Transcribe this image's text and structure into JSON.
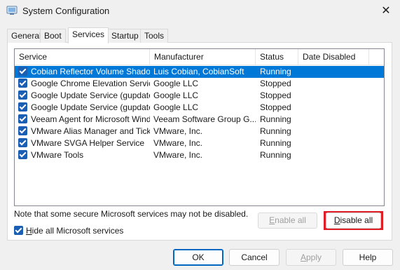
{
  "window": {
    "title": "System Configuration",
    "close_glyph": "✕"
  },
  "tabs": [
    {
      "label": "General",
      "active": false
    },
    {
      "label": "Boot",
      "active": false
    },
    {
      "label": "Services",
      "active": true
    },
    {
      "label": "Startup",
      "active": false
    },
    {
      "label": "Tools",
      "active": false
    }
  ],
  "services": {
    "columns": [
      "Service",
      "Manufacturer",
      "Status",
      "Date Disabled"
    ],
    "rows": [
      {
        "service": "Cobian Reflector Volume Shado...",
        "manufacturer": "Luis Cobian, CobianSoft",
        "status": "Running",
        "date_disabled": "",
        "checked": true,
        "selected": true
      },
      {
        "service": "Google Chrome Elevation Servic...",
        "manufacturer": "Google LLC",
        "status": "Stopped",
        "date_disabled": "",
        "checked": true,
        "selected": false
      },
      {
        "service": "Google Update Service (gupdate)",
        "manufacturer": "Google LLC",
        "status": "Stopped",
        "date_disabled": "",
        "checked": true,
        "selected": false
      },
      {
        "service": "Google Update Service (gupdatem)",
        "manufacturer": "Google LLC",
        "status": "Stopped",
        "date_disabled": "",
        "checked": true,
        "selected": false
      },
      {
        "service": "Veeam Agent for Microsoft Wind...",
        "manufacturer": "Veeam Software Group G...",
        "status": "Running",
        "date_disabled": "",
        "checked": true,
        "selected": false
      },
      {
        "service": "VMware Alias Manager and Ticke...",
        "manufacturer": "VMware, Inc.",
        "status": "Running",
        "date_disabled": "",
        "checked": true,
        "selected": false
      },
      {
        "service": "VMware SVGA Helper Service",
        "manufacturer": "VMware, Inc.",
        "status": "Running",
        "date_disabled": "",
        "checked": true,
        "selected": false
      },
      {
        "service": "VMware Tools",
        "manufacturer": "VMware, Inc.",
        "status": "Running",
        "date_disabled": "",
        "checked": true,
        "selected": false
      }
    ]
  },
  "note": "Note that some secure Microsoft services may not be disabled.",
  "actions": {
    "enable_all_first": "E",
    "enable_all_rest": "nable all",
    "enable_all_enabled": false,
    "disable_all_first": "D",
    "disable_all_rest": "isable all",
    "highlight_color": "#e01e26"
  },
  "hide_ms": {
    "first": "H",
    "rest": "ide all Microsoft services",
    "checked": true
  },
  "buttons": {
    "ok": "OK",
    "cancel": "Cancel",
    "apply_first": "A",
    "apply_rest": "pply",
    "help": "Help"
  },
  "colors": {
    "selection": "#0078d7",
    "checkbox": "#1a5fb4"
  }
}
